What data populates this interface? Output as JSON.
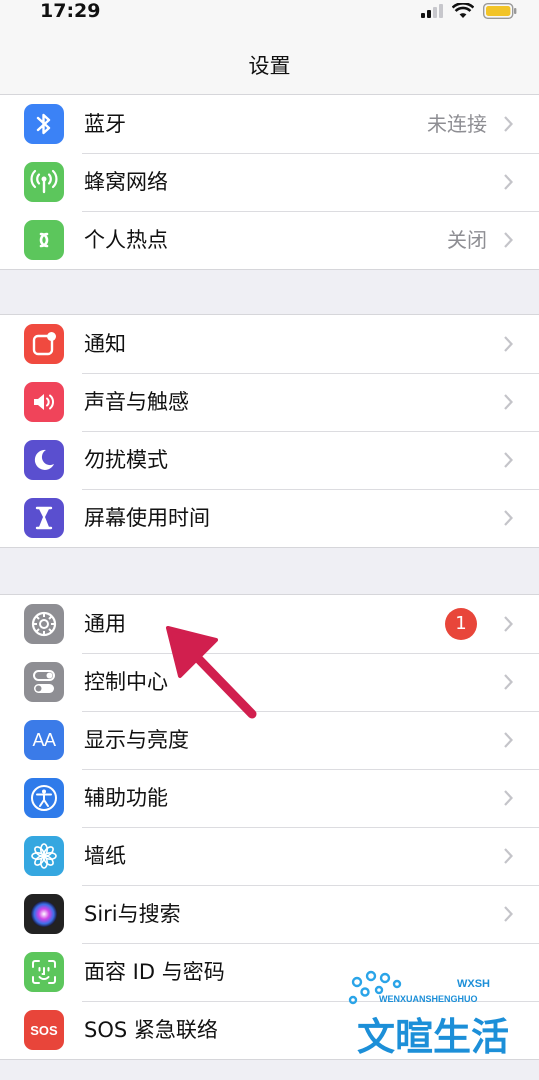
{
  "status_bar": {
    "time": "17:29"
  },
  "nav": {
    "title": "设置"
  },
  "groups": [
    [
      {
        "label": "蓝牙",
        "value": "未连接",
        "icon": "bluetooth-icon",
        "color": "#3b82f6"
      },
      {
        "label": "蜂窝网络",
        "value": "",
        "icon": "cellular-icon",
        "color": "#5cc65c"
      },
      {
        "label": "个人热点",
        "value": "关闭",
        "icon": "hotspot-icon",
        "color": "#5cc65c"
      }
    ],
    [
      {
        "label": "通知",
        "icon": "notification-icon",
        "color": "#f04a3f"
      },
      {
        "label": "声音与触感",
        "icon": "sound-icon",
        "color": "#f0445a"
      },
      {
        "label": "勿扰模式",
        "icon": "moon-icon",
        "color": "#5a4fcf"
      },
      {
        "label": "屏幕使用时间",
        "icon": "hourglass-icon",
        "color": "#5a4fcf"
      }
    ],
    [
      {
        "label": "通用",
        "badge": "1",
        "icon": "gear-icon",
        "color": "#8e8e93"
      },
      {
        "label": "控制中心",
        "icon": "toggle-icon",
        "color": "#8e8e93"
      },
      {
        "label": "显示与亮度",
        "icon": "text-size-icon",
        "color": "#3b7be8"
      },
      {
        "label": "辅助功能",
        "icon": "accessibility-icon",
        "color": "#2f7bea"
      },
      {
        "label": "墙纸",
        "icon": "flower-icon",
        "color": "#35a7e0"
      },
      {
        "label": "Siri与搜索",
        "icon": "siri-icon",
        "color": "#222222"
      },
      {
        "label": "面容 ID 与密码",
        "icon": "face-id-icon",
        "color": "#5cc65c"
      },
      {
        "label": "SOS 紧急联络",
        "icon": "sos-icon",
        "color": "#e8453a"
      }
    ]
  ],
  "sos_icon_text": "SOS",
  "display_icon_text": "AA",
  "watermark": {
    "text": "文暄生活",
    "sub": "WENXUANSHENGHUO",
    "mono": "WXSH"
  },
  "colors": {
    "accent": "#d11f4e",
    "badge": "#e8463a",
    "watermark": "#1c8fd8"
  }
}
